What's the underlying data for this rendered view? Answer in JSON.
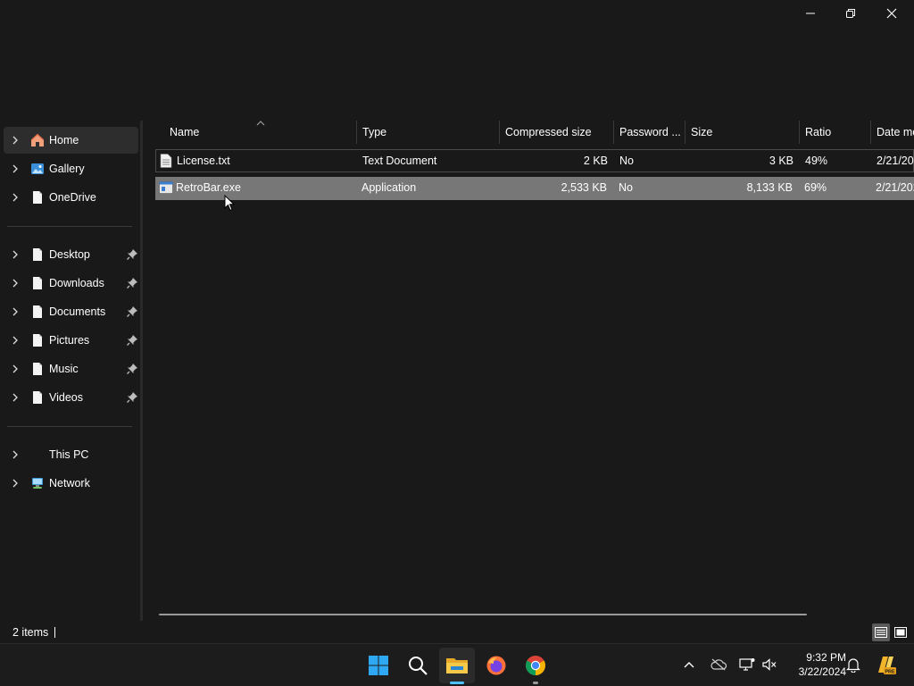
{
  "window_controls": {
    "minimize": "minimize-icon",
    "maximize": "restore-icon",
    "close": "close-icon"
  },
  "nav": {
    "items": [
      {
        "label": "Home",
        "icon": "home-icon",
        "selected": true,
        "pinned": false
      },
      {
        "label": "Gallery",
        "icon": "gallery-icon",
        "pinned": false
      },
      {
        "label": "OneDrive",
        "icon": "file-icon",
        "pinned": false
      },
      {
        "label": "Desktop",
        "icon": "file-icon",
        "pinned": true
      },
      {
        "label": "Downloads",
        "icon": "file-icon",
        "pinned": true
      },
      {
        "label": "Documents",
        "icon": "file-icon",
        "pinned": true
      },
      {
        "label": "Pictures",
        "icon": "file-icon",
        "pinned": true
      },
      {
        "label": "Music",
        "icon": "file-icon",
        "pinned": true
      },
      {
        "label": "Videos",
        "icon": "file-icon",
        "pinned": true
      },
      {
        "label": "This PC",
        "icon": "none",
        "pinned": false
      },
      {
        "label": "Network",
        "icon": "network-icon",
        "pinned": false
      }
    ]
  },
  "columns": {
    "name": "Name",
    "type": "Type",
    "compressed_size": "Compressed size",
    "password": "Password ...",
    "size": "Size",
    "ratio": "Ratio",
    "date": "Date mo"
  },
  "rows": [
    {
      "name": "License.txt",
      "icon": "text-file-icon",
      "type": "Text Document",
      "compressed_size": "2 KB",
      "password": "No",
      "size": "3 KB",
      "ratio": "49%",
      "date": "2/21/202"
    },
    {
      "name": "RetroBar.exe",
      "icon": "application-icon",
      "type": "Application",
      "compressed_size": "2,533 KB",
      "password": "No",
      "size": "8,133 KB",
      "ratio": "69%",
      "date": "2/21/202"
    }
  ],
  "status": {
    "item_count": "2 items"
  },
  "taskbar": {
    "apps": [
      "start-icon",
      "search-icon",
      "file-explorer-icon",
      "firefox-icon",
      "chrome-icon"
    ],
    "clock_time": "9:32 PM",
    "clock_date": "3/22/2024"
  },
  "colors": {
    "background": "#191919",
    "selected_row": "#777777",
    "accent": "#0a84ff"
  }
}
